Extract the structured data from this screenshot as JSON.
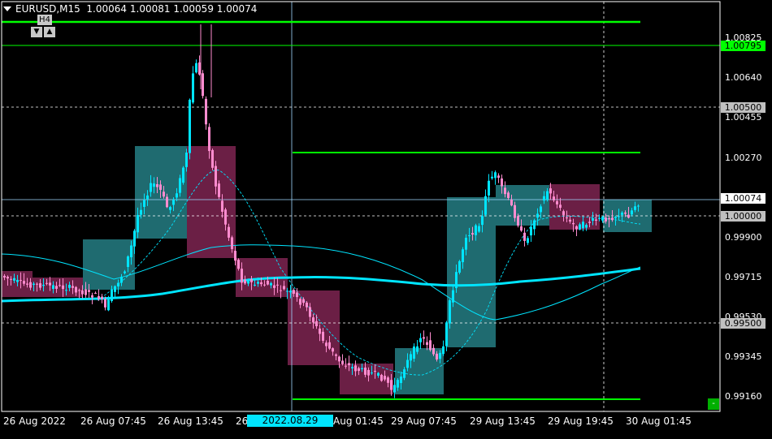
{
  "header": {
    "symbol_timeframe": "EURUSD,M15",
    "open": "1.00064",
    "high": "1.00081",
    "low": "1.00059",
    "close": "1.00074"
  },
  "timeframe_control": {
    "label": "H4",
    "down_icon": "▼",
    "up_icon": "▲"
  },
  "price_ticks": [
    "1.00825",
    "1.00640",
    "1.00455",
    "1.00270",
    "0.99900",
    "0.99715",
    "0.99530",
    "0.99345",
    "0.99160"
  ],
  "price_boxes": [
    {
      "text": "1.00795",
      "bg": "#00ff00",
      "fg": "#000000"
    },
    {
      "text": "1.00500",
      "bg": "#c0c0c0",
      "fg": "#000000"
    },
    {
      "text": "1.00074",
      "bg": "#ffffff",
      "fg": "#000000"
    },
    {
      "text": "1.00000",
      "bg": "#c0c0c0",
      "fg": "#000000"
    },
    {
      "text": "0.99500",
      "bg": "#c0c0c0",
      "fg": "#000000"
    }
  ],
  "time_labels": [
    "26 Aug 2022",
    "26 Aug 07:45",
    "26 Aug 13:45",
    "26",
    "Aug 01:45",
    "29 Aug 07:45",
    "29 Aug 13:45",
    "29 Aug 19:45",
    "30 Aug 01:45"
  ],
  "crosshair_time": "2022.08.29 00:00",
  "mini_button": "-",
  "colors": {
    "background": "#000000",
    "bull_candle": "#00e5ff",
    "bear_candle": "#ff8ccf",
    "bull_box": "#1f6b70",
    "bear_box": "#6b1f45",
    "level_line": "#00ff00",
    "ma_line": "#00e5ff"
  }
}
